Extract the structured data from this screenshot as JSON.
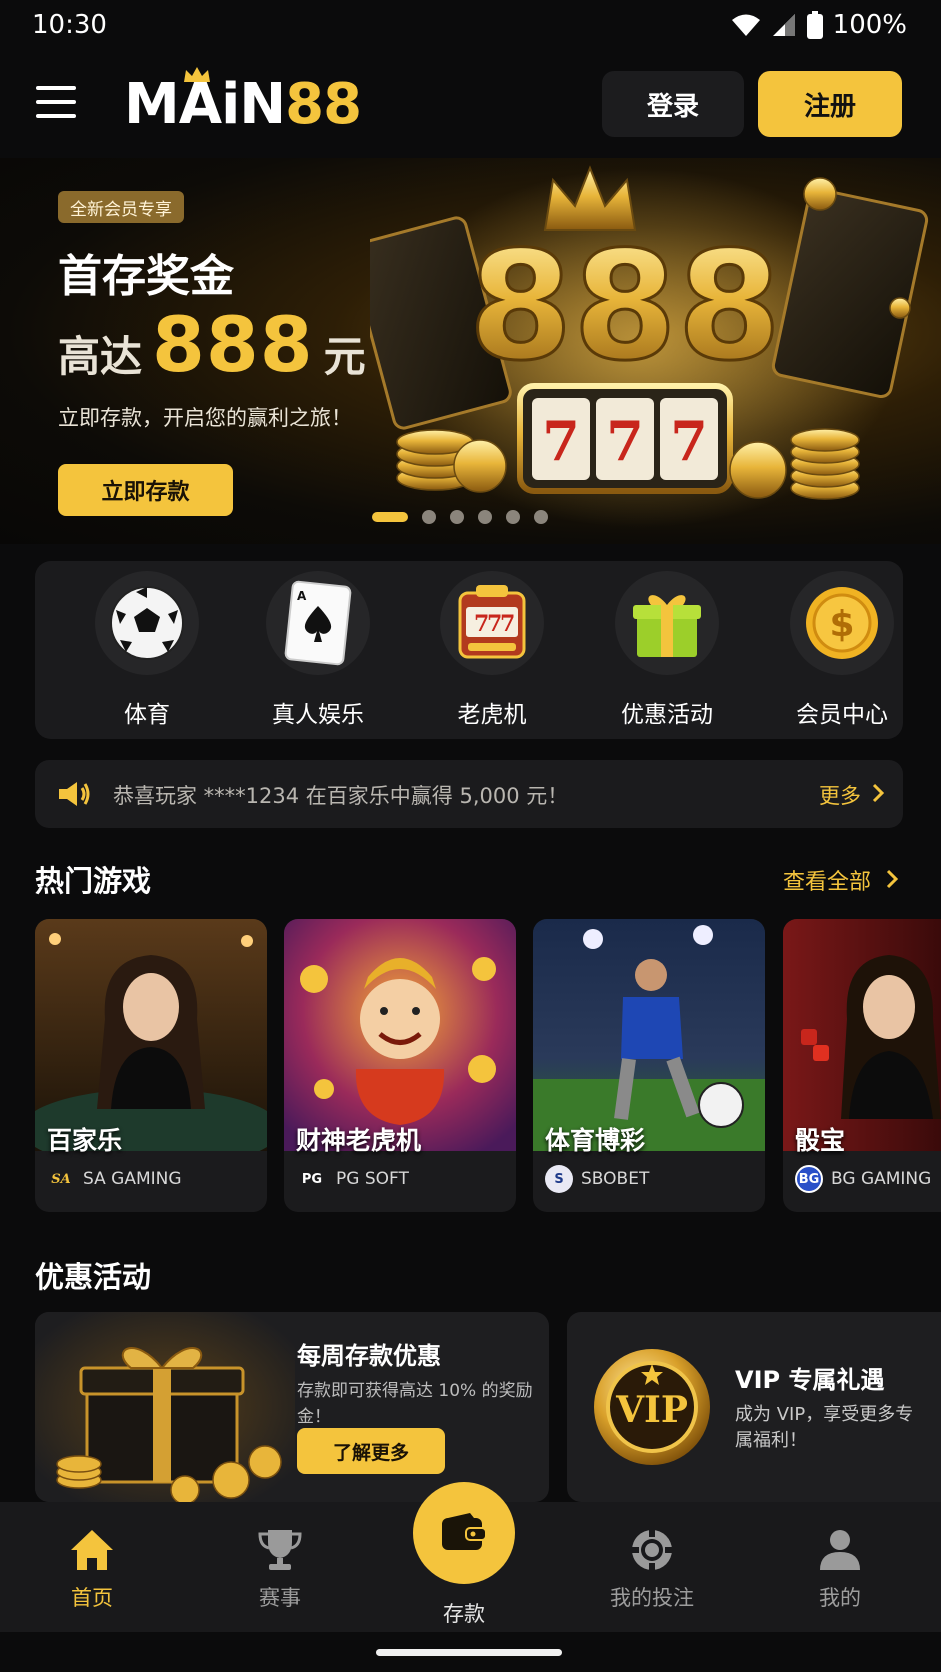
{
  "status_bar": {
    "time": "10:30",
    "battery": "100%"
  },
  "header": {
    "logo_main": "MAiN",
    "logo_num": "88",
    "login_label": "登录",
    "register_label": "注册",
    "brand_color": "#f4c43d"
  },
  "banner": {
    "tag": "全新会员专享",
    "title": "首存奖金",
    "amount_prefix": "高达",
    "amount": "888",
    "amount_suffix": "元",
    "subtitle": "立即存款，开启您的赢利之旅！",
    "cta": "立即存款",
    "art_number": "888",
    "slides": 6,
    "active_slide": 1
  },
  "categories": [
    {
      "label": "体育",
      "icon": "soccer-ball-icon"
    },
    {
      "label": "真人娱乐",
      "icon": "playing-card-icon"
    },
    {
      "label": "老虎机",
      "icon": "slot-machine-icon"
    },
    {
      "label": "优惠活动",
      "icon": "gift-icon"
    },
    {
      "label": "会员中心",
      "icon": "gold-coin-icon"
    }
  ],
  "ticker": {
    "text": "恭喜玩家 ****1234 在百家乐中赢得 5,000 元！",
    "more": "更多"
  },
  "hot_games": {
    "title": "热门游戏",
    "view_all": "查看全部",
    "items": [
      {
        "name": "百家乐",
        "provider": "SA GAMING",
        "provider_mark": "SA"
      },
      {
        "name": "财神老虎机",
        "provider": "PG SOFT",
        "provider_mark": "PG"
      },
      {
        "name": "体育博彩",
        "provider": "SBOBET",
        "provider_mark": "S"
      },
      {
        "name": "骰宝",
        "provider": "BG GAMING",
        "provider_mark": "BG"
      }
    ]
  },
  "promotions": {
    "title": "优惠活动",
    "weekly": {
      "title": "每周存款优惠",
      "desc": "存款即可获得高达 10% 的奖励金！",
      "cta": "了解更多"
    },
    "vip": {
      "title": "VIP 专属礼遇",
      "desc": "成为 VIP，享受更多专属福利！",
      "badge": "VIP"
    }
  },
  "bottom_nav": {
    "home": "首页",
    "events": "赛事",
    "deposit": "存款",
    "my_bets": "我的投注",
    "me": "我的"
  }
}
